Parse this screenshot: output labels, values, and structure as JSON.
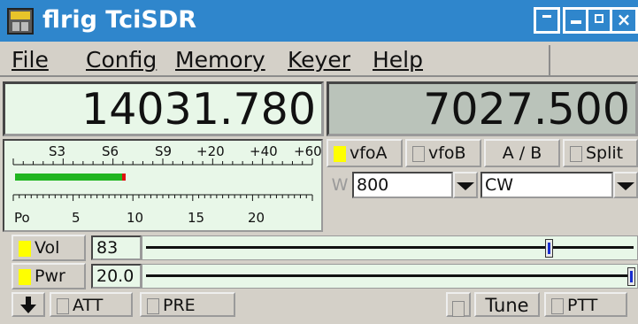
{
  "window": {
    "title": "flrig TciSDR"
  },
  "menu": {
    "items": [
      "File",
      "Config",
      "Memory",
      "Keyer",
      "Help"
    ]
  },
  "vfo": {
    "a_freq": "14031.780",
    "b_freq": "7027.500"
  },
  "meter": {
    "s_scale": [
      "S3",
      "S6",
      "S9",
      "+20",
      "+40",
      "+60"
    ],
    "po_label": "Po",
    "po_scale": [
      "5",
      "10",
      "15",
      "20"
    ],
    "signal_level_fraction": 0.36
  },
  "buttons": {
    "vfoa": "vfoA",
    "vfob": "vfoB",
    "a_b": "A / B",
    "split": "Split",
    "w_label": "W",
    "vol": "Vol",
    "pwr": "Pwr",
    "att": "ATT",
    "pre": "PRE",
    "tune": "Tune",
    "ptt": "PTT"
  },
  "bandwidth": {
    "value": "800"
  },
  "mode": {
    "value": "CW"
  },
  "volume": {
    "value": "83",
    "fraction": 0.83
  },
  "power": {
    "value": "20.0",
    "fraction": 1.0
  },
  "colors": {
    "titlebar": "#2f86cc",
    "led_on": "#ffff00",
    "display_bg": "#e8f7e8",
    "vfob_bg": "#bac3ba"
  },
  "icons": {
    "app": "flrig-app-icon",
    "more": "down-arrow-icon"
  }
}
